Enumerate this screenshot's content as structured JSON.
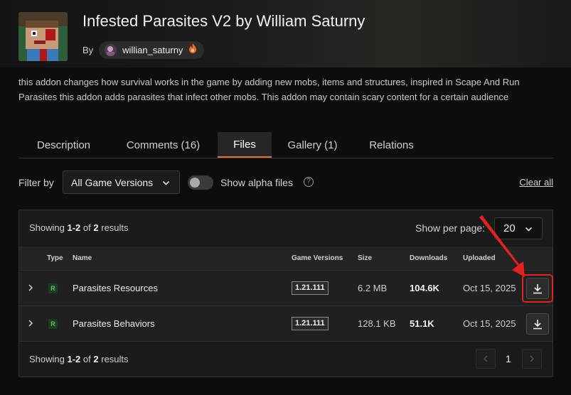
{
  "addon": {
    "title": "Infested Parasites V2 by William Saturny",
    "by_label": "By",
    "author": "willian_saturny",
    "description": "this addon changes how survival works in the game by adding new mobs, items and structures, inspired in Scape And Run Parasites this addon adds parasites that infect other mobs. This addon may contain scary content for a certain audience"
  },
  "tabs": [
    {
      "label": "Description",
      "active": false
    },
    {
      "label": "Comments (16)",
      "active": false
    },
    {
      "label": "Files",
      "active": true
    },
    {
      "label": "Gallery (1)",
      "active": false
    },
    {
      "label": "Relations",
      "active": false
    }
  ],
  "filters": {
    "filter_label": "Filter by",
    "game_versions_value": "All Game Versions",
    "alpha_label": "Show alpha files",
    "alpha_enabled": false,
    "clear_all": "Clear all"
  },
  "results": {
    "showing_prefix": "Showing",
    "range": "1-2",
    "of": "of",
    "total": "2",
    "results_word": "results",
    "per_page_label": "Show per page:",
    "per_page_value": "20"
  },
  "table": {
    "headers": {
      "type": "Type",
      "name": "Name",
      "game_versions": "Game Versions",
      "size": "Size",
      "downloads": "Downloads",
      "uploaded": "Uploaded"
    },
    "rows": [
      {
        "type": "R",
        "name": "Parasites Resources",
        "version": "1.21.111",
        "size": "6.2 MB",
        "downloads": "104.6K",
        "uploaded": "Oct 15, 2025"
      },
      {
        "type": "R",
        "name": "Parasites Behaviors",
        "version": "1.21.111",
        "size": "128.1 KB",
        "downloads": "51.1K",
        "uploaded": "Oct 15, 2025"
      }
    ]
  },
  "pagination": {
    "current_page": "1"
  },
  "colors": {
    "accent": "#e8703a",
    "release_badge": "#52c46a",
    "highlight": "#e52020"
  }
}
